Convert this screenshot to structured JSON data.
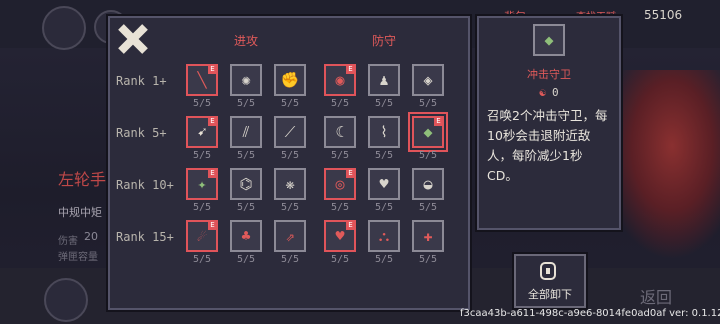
{
  "background": {
    "currency": "55106",
    "tab_left": "背包",
    "tab_mid": "查找天赋",
    "weapon_name": "左轮手",
    "weapon_type": "中规中矩",
    "stat_damage_label": "伤害",
    "stat_damage_value": "20",
    "stat_ammo_label": "弹匣容量",
    "back_label": "返回"
  },
  "talent_panel": {
    "column_attack": "进攻",
    "column_defense": "防守",
    "ranks": [
      "Rank 1+",
      "Rank 5+",
      "Rank 10+",
      "Rank 15+"
    ],
    "level_text": "5/5",
    "badge": "E"
  },
  "info_panel": {
    "name": "冲击守卫",
    "cost": "0",
    "description": "召唤2个冲击守卫，每10秒会击退附近敌人，每阶减少1秒CD。"
  },
  "unequip_all": {
    "label": "全部卸下"
  },
  "version_text": "f3caa43b-a611-498c-a9e6-8014fe0ad0af ver: 0.1.12",
  "colors": {
    "accent_red": "#e05a5a",
    "panel_bg": "#2c2b3b",
    "slot_border": "#8c8a96"
  }
}
